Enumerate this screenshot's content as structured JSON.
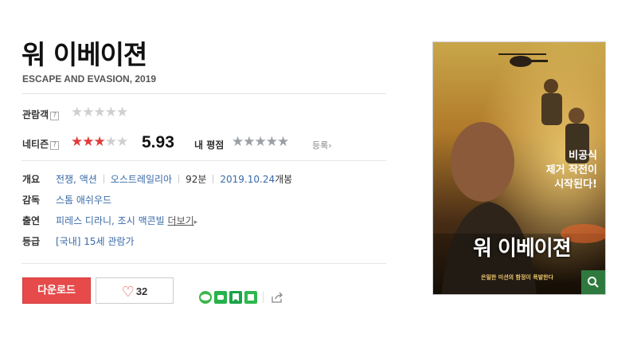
{
  "movie": {
    "title": "워 이베이젼",
    "subtitle": "ESCAPE AND EVASION, 2019"
  },
  "ratings": {
    "audience_label": "관람객",
    "audience_stars": 0,
    "netizen_label": "네티즌",
    "netizen_stars": 3,
    "netizen_score": "5.93",
    "my_rating_label": "내 평점",
    "register_label": "등록",
    "help_mark": "?"
  },
  "info": {
    "overview_label": "개요",
    "genres": "전쟁, 액션",
    "country": "오스트레일리아",
    "runtime": "92분",
    "release_date": "2019.10.24",
    "release_suffix": "개봉",
    "director_label": "감독",
    "director": "스톰 애쉬우드",
    "cast_label": "출연",
    "cast": "피레스 디라니, 조시 맥콘빌",
    "more_label": "더보기",
    "grade_label": "등급",
    "grade": "[국내] 15세 관람가"
  },
  "actions": {
    "download_label": "다운로드",
    "like_count": "32"
  },
  "share_icons": [
    "line-icon",
    "band-icon",
    "bookmark-icon",
    "memo-icon",
    "share-icon"
  ],
  "poster": {
    "tagline_1": "비공식",
    "tagline_2": "제거 작전이",
    "tagline_3": "시작된다!",
    "title_text": "워 이베이젼",
    "bottom_text": "은밀한 미션의 함정이 폭발한다"
  },
  "colors": {
    "accent_red": "#e64a4a",
    "link_blue": "#3a6aa8"
  }
}
